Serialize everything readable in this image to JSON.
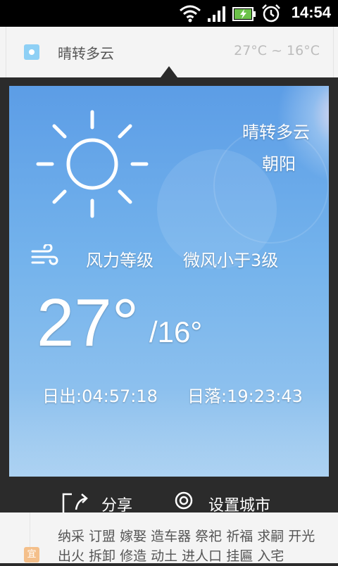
{
  "status_bar": {
    "time": "14:54"
  },
  "background_card": {
    "weather": "晴转多云",
    "temp_range": "27°C ~ 16°C"
  },
  "panel": {
    "condition": "晴转多云",
    "city": "朝阳",
    "wind_label": "风力等级",
    "wind_value": "微风小于3级",
    "temp_high": "27°",
    "temp_low": "/16°",
    "sunrise": "日出:04:57:18",
    "sunset": "日落:19:23:43"
  },
  "actions": {
    "share_label": "分享",
    "set_city_label": "设置城市"
  },
  "almanac": {
    "badge": "宜",
    "text": "纳采 订盟 嫁娶 造车器 祭祀 祈福 求嗣 开光 出火 拆卸 修造 动土 进人口 挂匾 入宅"
  }
}
